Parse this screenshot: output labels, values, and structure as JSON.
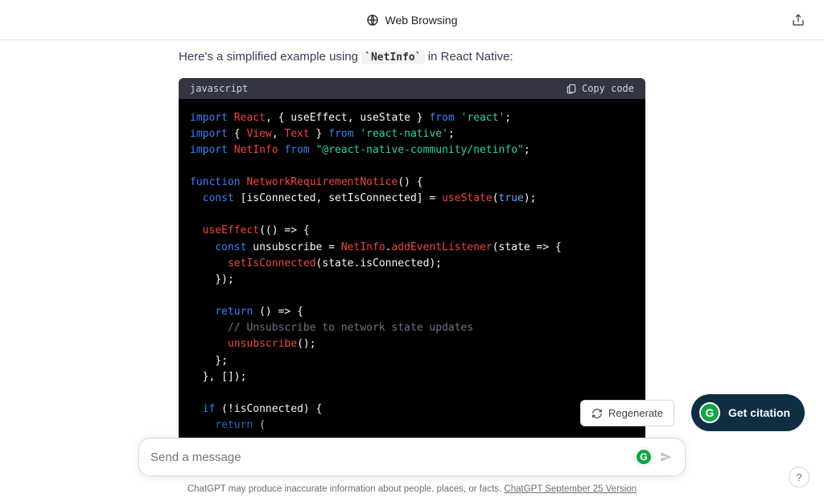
{
  "header": {
    "title": "Web Browsing"
  },
  "message": {
    "intro_before": "Here's a simplified example using ",
    "intro_code": "NetInfo",
    "intro_after": " in React Native:"
  },
  "code": {
    "language": "javascript",
    "copy_label": "Copy code",
    "tokens": {
      "import": "import",
      "from": "from",
      "function": "function",
      "const": "const",
      "return": "return",
      "if": "if",
      "React": "React",
      "useEffect": "useEffect",
      "useState": "useState",
      "View": "View",
      "Text": "Text",
      "NetInfo": "NetInfo",
      "react_str": "'react'",
      "react_native_str": "'react-native'",
      "netinfo_str": "\"@react-native-community/netinfo\"",
      "fn_name": "NetworkRequirementNotice",
      "isConnected": "isConnected",
      "setIsConnected": "setIsConnected",
      "true": "true",
      "unsubscribe": "unsubscribe",
      "addEventListener": "addEventListener",
      "state": "state",
      "comment": "// Unsubscribe to network state updates"
    }
  },
  "actions": {
    "regenerate": "Regenerate",
    "get_citation": "Get citation"
  },
  "composer": {
    "placeholder": "Send a message"
  },
  "footer": {
    "text": "ChatGPT may produce inaccurate information about people, places, or facts. ",
    "link": "ChatGPT September 25 Version"
  },
  "help": "?"
}
